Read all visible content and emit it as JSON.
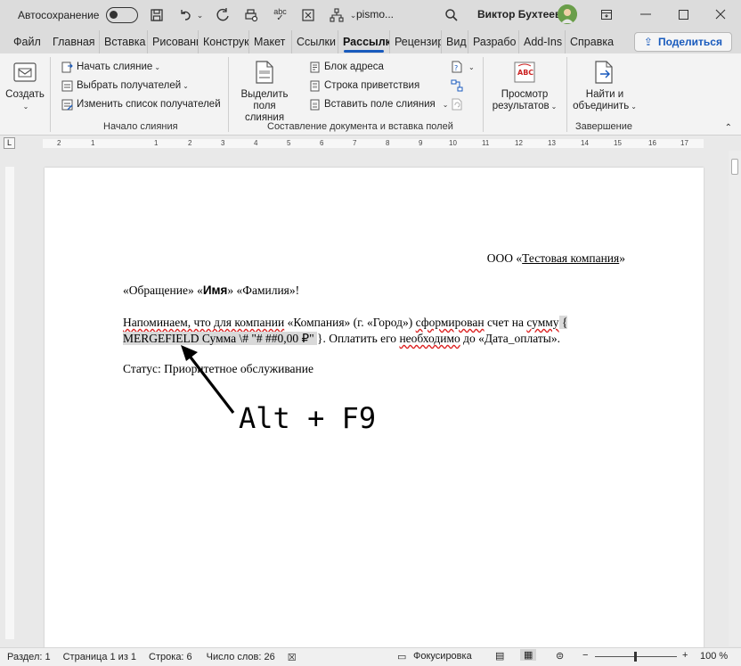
{
  "titlebar": {
    "autosave_label": "Автосохранение",
    "doc_name": "pismo...",
    "user_name": "Виктор Бухтеев",
    "icons": [
      "toggle-off",
      "save-icon",
      "undo-icon",
      "redo-icon",
      "print-preview-icon",
      "spelling-icon",
      "touch-mode-icon",
      "tree-icon",
      "search-icon",
      "avatar",
      "ribbon-display-icon",
      "minimize-icon",
      "maximize-icon",
      "close-icon"
    ]
  },
  "tabs": [
    "Файл",
    "Главная",
    "Вставка",
    "Рисовани",
    "Конструк",
    "Макет",
    "Ссылки",
    "Рассылк",
    "Рецензир",
    "Вид",
    "Разрабо",
    "Add-Ins",
    "Справка"
  ],
  "active_tab": "Рассылк",
  "share_label": "Поделиться",
  "accent_color": "#185abd",
  "ribbon": {
    "create": {
      "label": "Создать"
    },
    "start_merge": {
      "items": [
        "Начать слияние",
        "Выбрать получателей",
        "Изменить список получателей"
      ],
      "group_label": "Начало слияния"
    },
    "compose": {
      "highlight_label": "Выделить поля слияния",
      "items": [
        "Блок адреса",
        "Строка приветствия",
        "Вставить поле слияния"
      ],
      "group_label": "Составление документа и вставка полей"
    },
    "preview": {
      "label": "Просмотр результатов",
      "badge": "ABC"
    },
    "finish": {
      "label": "Найти и объединить",
      "group_label": "Завершение"
    }
  },
  "ruler": {
    "numbers": [
      "2",
      "1",
      "1",
      "2",
      "3",
      "4",
      "5",
      "6",
      "7",
      "8",
      "9",
      "10",
      "11",
      "12",
      "13",
      "14",
      "15",
      "16",
      "17",
      "18"
    ]
  },
  "document": {
    "company_prefix": "ООО «",
    "company_name": "Тестовая компания",
    "company_suffix": "»",
    "greeting_1": "«Обращение» «",
    "greeting_name": "Имя",
    "greeting_2": "»  «Фамилия»!",
    "para_1a": "Напоминаем, что для компании",
    "para_1b": " «Компания» (г. «Город») ",
    "para_1c": "сформирован",
    "para_1d": " счет на ",
    "para_1e": "сумму",
    "para_1f": " {",
    "field_code": " MERGEFIELD Сумма \\# \"# ##0,00 ₽\" ",
    "para_2b": "}. Оплатить его ",
    "para_2c": "необходимо",
    "para_2d": " до «Дата_оплаты».",
    "status_line": "Статус: Приоритетное обслуживание"
  },
  "annotation": "Alt + F9",
  "statusbar": {
    "section": "Раздел: 1",
    "page": "Страница 1 из 1",
    "line": "Строка: 6",
    "words": "Число слов: 26",
    "focus": "Фокусировка",
    "zoom": "100 %"
  }
}
